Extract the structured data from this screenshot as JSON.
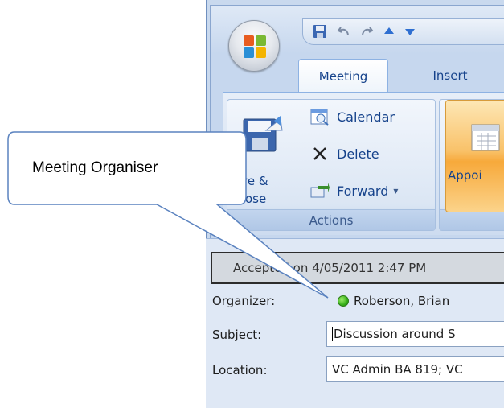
{
  "qat": {
    "items": [
      "save-icon",
      "undo-icon",
      "redo-icon",
      "previous-item-icon",
      "next-item-icon"
    ]
  },
  "tabs": [
    {
      "label": "Meeting",
      "active": true
    },
    {
      "label": "Insert",
      "active": false
    }
  ],
  "ribbon": {
    "actions_group": {
      "label": "Actions",
      "save_close_line1": "ve &",
      "save_close_line2": "ose",
      "calendar_label": "Calendar",
      "delete_label": "Delete",
      "forward_label": "Forward",
      "forward_dropdown": "▾"
    },
    "appointment_label": "Appoi"
  },
  "form": {
    "banner_text": "Accepted on 4/05/2011 2:47 PM",
    "organizer_label": "Organizer:",
    "organizer_value": "Roberson, Brian",
    "subject_label": "Subject:",
    "subject_value": "Discussion around S",
    "location_label": "Location:",
    "location_value": "VC Admin BA 819; VC"
  },
  "callout": {
    "text": "Meeting Organiser"
  },
  "colors": {
    "ribbon_text": "#15428b",
    "presence_available": "#37b01a",
    "appointment_highlight": "#f9c26a"
  }
}
